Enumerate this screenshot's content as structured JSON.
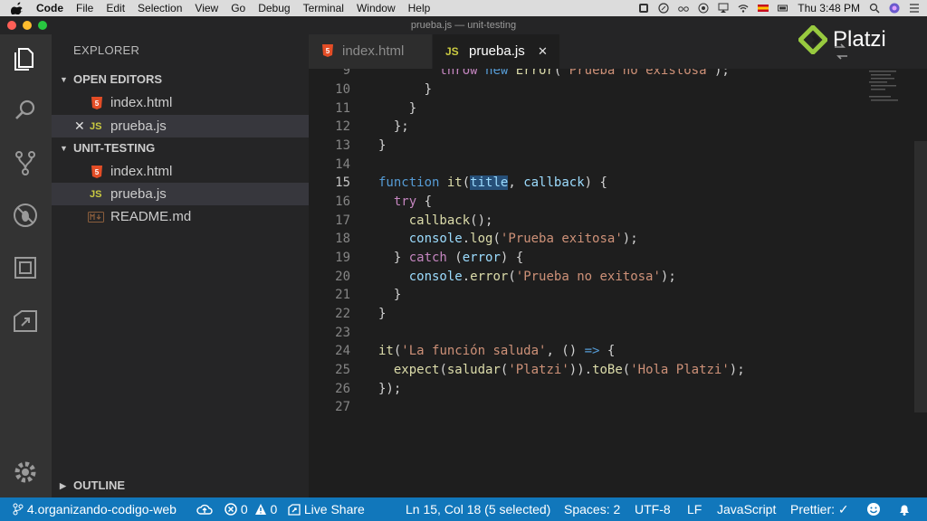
{
  "menubar": {
    "app": "Code",
    "items": [
      "File",
      "Edit",
      "Selection",
      "View",
      "Go",
      "Debug",
      "Terminal",
      "Window",
      "Help"
    ],
    "clock": "Thu 3:48 PM"
  },
  "window": {
    "title": "prueba.js — unit-testing"
  },
  "sidebar": {
    "title": "EXPLORER",
    "open_editors_label": "OPEN EDITORS",
    "open_editors": [
      {
        "name": "index.html",
        "icon": "html5-icon"
      },
      {
        "name": "prueba.js",
        "icon": "js-icon",
        "close": "✕",
        "badge": "JS"
      }
    ],
    "folder_label": "UNIT-TESTING",
    "files": [
      {
        "name": "index.html",
        "icon": "html5-icon"
      },
      {
        "name": "prueba.js",
        "icon": "js-icon",
        "badge": "JS"
      },
      {
        "name": "README.md",
        "icon": "markdown-icon"
      }
    ],
    "outline_label": "OUTLINE"
  },
  "tabs": [
    {
      "label": "index.html",
      "icon": "html5-icon",
      "active": false
    },
    {
      "label": "prueba.js",
      "icon": "js-icon",
      "badge": "JS",
      "active": true,
      "close": "✕"
    }
  ],
  "editor": {
    "current_line": 15,
    "line_numbers": [
      "9",
      "10",
      "11",
      "12",
      "13",
      "14",
      "15",
      "16",
      "17",
      "18",
      "19",
      "20",
      "21",
      "22",
      "23",
      "24",
      "25",
      "26",
      "27"
    ]
  },
  "brand": {
    "name": "Platzi",
    "color": "#98ca3f"
  },
  "statusbar": {
    "branch": "4.organizando-codigo-web",
    "errors": "0",
    "warnings": "0",
    "live_share": "Live Share",
    "cursor": "Ln 15, Col 18 (5 selected)",
    "spaces": "Spaces: 2",
    "encoding": "UTF-8",
    "eol": "LF",
    "language": "JavaScript",
    "prettier": "Prettier: ✓",
    "color": "#1177bb"
  }
}
